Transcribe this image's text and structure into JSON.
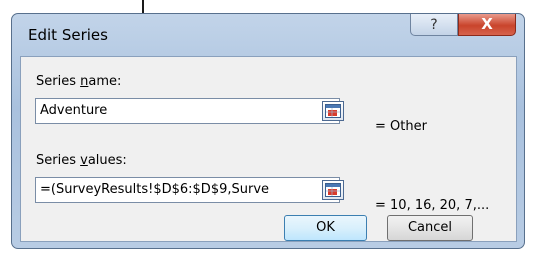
{
  "dialog": {
    "title": "Edit Series",
    "help_glyph": "?",
    "close_glyph": "X"
  },
  "series_name": {
    "label_pre": "Series ",
    "label_key": "n",
    "label_post": "ame:",
    "value": "Adventure",
    "result": "= Other",
    "ref_icon": "range-select-icon"
  },
  "series_values": {
    "label_pre": "Series ",
    "label_key": "v",
    "label_post": "alues:",
    "value": "=(SurveyResults!$D$6:$D$9,Surve",
    "result": "= 10, 16, 20, 7,...",
    "ref_icon": "range-select-icon"
  },
  "buttons": {
    "ok": "OK",
    "cancel": "Cancel"
  }
}
